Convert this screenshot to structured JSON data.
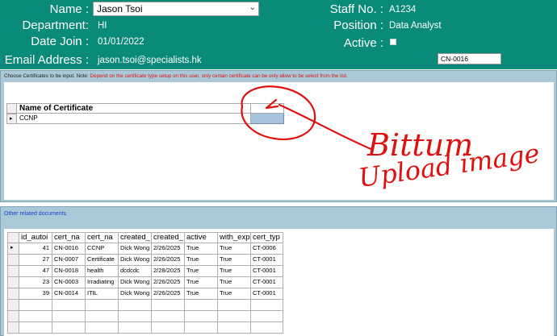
{
  "header": {
    "name_label": "Name :",
    "name_value": "Jason Tsoi",
    "department_label": "Department:",
    "department_value": "HI",
    "date_join_label": "Date Join :",
    "date_join_value": "01/01/2022",
    "email_label": "Email Address :",
    "email_value": "jason.tsoi@specialists.hk",
    "staff_no_label": "Staff No. :",
    "staff_no_value": "A1234",
    "position_label": "Position :",
    "position_value": "Data Analyst",
    "active_label": "Active :",
    "cert_id_value": "CN-0016",
    "bg_color": "#0a8a78"
  },
  "certificates": {
    "note_prefix": "Choose Certificates to be input. Note: ",
    "note_red": "Depend on the certificate type setup on this user, only certain certificate can be only allow to be select from the list.",
    "column_name": "Name of Certificate",
    "rows": [
      {
        "name": "CCNP"
      }
    ]
  },
  "annotation": {
    "line1": "Bittum",
    "line2": "Upload image",
    "color": "#e01010"
  },
  "related": {
    "title": "Other related documents",
    "columns": [
      "id_autoi",
      "cert_na",
      "cert_na",
      "created_",
      "created_",
      "active",
      "with_exp",
      "cert_typ"
    ],
    "rows": [
      [
        "41",
        "CN-0016",
        "CCNP",
        "Dick Wong",
        "2/26/2025",
        "True",
        "True",
        "CT-0006"
      ],
      [
        "27",
        "CN-0007",
        "Certificate",
        "Dick Wong",
        "2/26/2025",
        "True",
        "True",
        "CT-0001"
      ],
      [
        "47",
        "CN-0018",
        "health",
        "dcdcdc",
        "2/28/2025",
        "True",
        "True",
        "CT-0001"
      ],
      [
        "23",
        "CN-0003",
        "Irradiating",
        "Dick Wong",
        "2/26/2025",
        "True",
        "True",
        "CT-0001"
      ],
      [
        "39",
        "CN-0014",
        "ITIL",
        "Dick Wong",
        "2/26/2025",
        "True",
        "True",
        "CT-0001"
      ]
    ]
  }
}
